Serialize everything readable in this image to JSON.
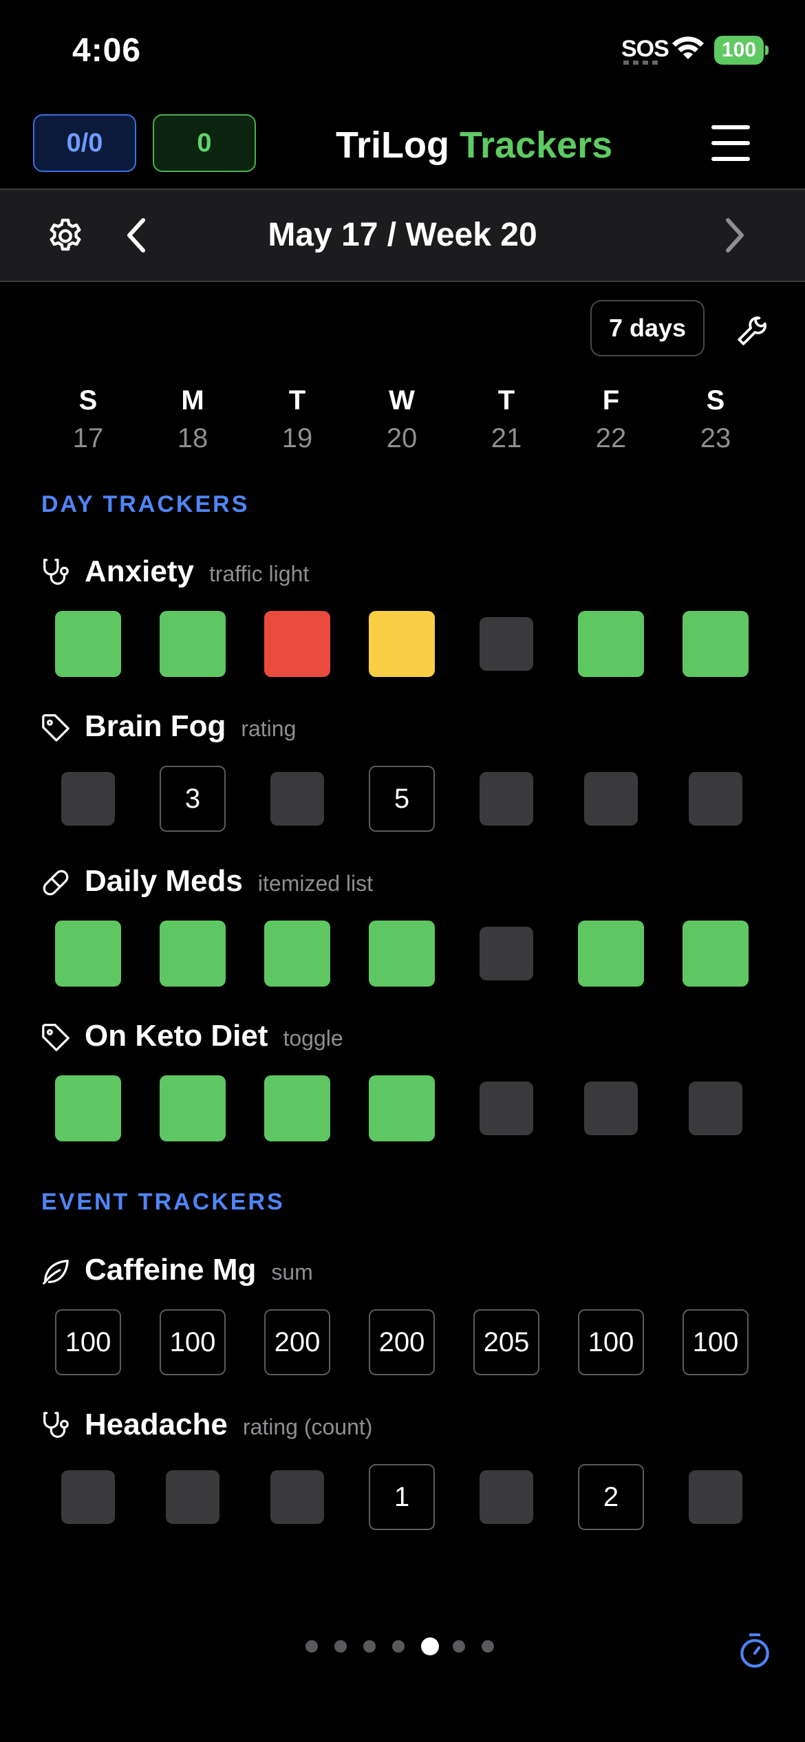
{
  "status": {
    "time": "4:06",
    "sos": "SOS",
    "battery": "100"
  },
  "header": {
    "badge_left": "0/0",
    "badge_right": "0",
    "title_part1": "TriLog",
    "title_part2": "Trackers"
  },
  "nav": {
    "date_title": "May 17 / Week 20"
  },
  "range_button": "7 days",
  "week": [
    {
      "letter": "S",
      "num": "17"
    },
    {
      "letter": "M",
      "num": "18"
    },
    {
      "letter": "T",
      "num": "19"
    },
    {
      "letter": "W",
      "num": "20"
    },
    {
      "letter": "T",
      "num": "21"
    },
    {
      "letter": "F",
      "num": "22"
    },
    {
      "letter": "S",
      "num": "23"
    }
  ],
  "sections": {
    "day": "DAY TRACKERS",
    "event": "EVENT TRACKERS"
  },
  "trackers": [
    {
      "name": "Anxiety",
      "type": "traffic light",
      "icon": "stethoscope-icon",
      "cells": [
        "green",
        "green",
        "red",
        "yellow",
        "empty",
        "green",
        "green"
      ]
    },
    {
      "name": "Brain Fog",
      "type": "rating",
      "icon": "tag-icon",
      "cells": [
        "empty",
        "3",
        "empty",
        "5",
        "empty",
        "empty",
        "empty"
      ]
    },
    {
      "name": "Daily Meds",
      "type": "itemized list",
      "icon": "pill-icon",
      "cells": [
        "green",
        "green",
        "green",
        "green",
        "empty",
        "green",
        "green"
      ]
    },
    {
      "name": "On Keto Diet",
      "type": "toggle",
      "icon": "tag-icon",
      "cells": [
        "green",
        "green",
        "green",
        "green",
        "empty",
        "empty",
        "empty"
      ]
    },
    {
      "name": "Caffeine Mg",
      "type": "sum",
      "icon": "leaf-icon",
      "cells": [
        "100",
        "100",
        "200",
        "200",
        "205",
        "100",
        "100"
      ]
    },
    {
      "name": "Headache",
      "type": "rating (count)",
      "icon": "stethoscope-icon",
      "cells": [
        "empty",
        "empty",
        "empty",
        "1",
        "empty",
        "2",
        "empty"
      ]
    }
  ],
  "pager": {
    "count": 7,
    "active_index": 4
  },
  "colors": {
    "green": "#5ec762",
    "red": "#e94b3c",
    "yellow": "#f8cf44",
    "empty": "#3a3a3c",
    "accent_blue": "#4f86f7",
    "title_green": "#5ecb62"
  }
}
